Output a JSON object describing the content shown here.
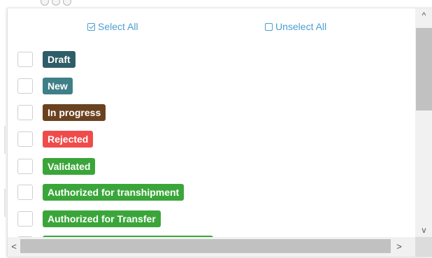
{
  "actions": {
    "select_all_label": "Select All",
    "unselect_all_label": "Unselect All",
    "link_color": "#4a9fd2"
  },
  "status_options": [
    {
      "label": "Draft",
      "color": "#2e5d67",
      "checked": false
    },
    {
      "label": "New",
      "color": "#3f7f88",
      "checked": false
    },
    {
      "label": "In progress",
      "color": "#6a4220",
      "checked": false
    },
    {
      "label": "Rejected",
      "color": "#f04b4b",
      "checked": false
    },
    {
      "label": "Validated",
      "color": "#3aa63a",
      "checked": false
    },
    {
      "label": "Authorized for transhipment",
      "color": "#3aa63a",
      "checked": false
    },
    {
      "label": "Authorized for Transfer",
      "color": "#3aa63a",
      "checked": false
    },
    {
      "label": "",
      "color": "#3aa63a",
      "checked": false
    }
  ],
  "scrollbars": {
    "up_arrow": "^",
    "down_arrow": "v",
    "left_arrow": "<",
    "right_arrow": ">"
  }
}
